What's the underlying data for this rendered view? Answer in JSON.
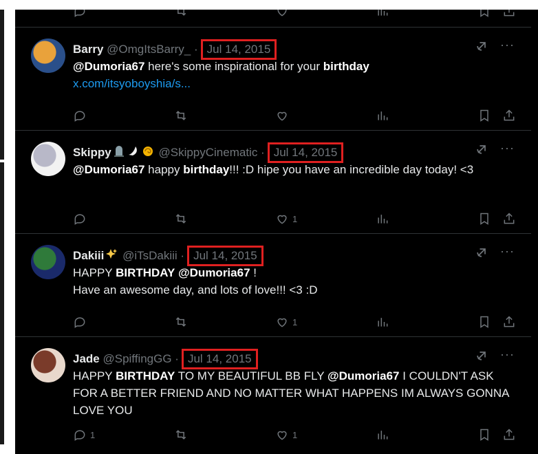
{
  "tweets": [
    {
      "name": "Barry",
      "emojis": [],
      "handle": "@OmgItsBarry_",
      "date": "Jul 14, 2015",
      "text_html_parts": [
        {
          "type": "b",
          "text": "@Dumoria67"
        },
        {
          "type": "t",
          "text": " here's some inspirational for your "
        },
        {
          "type": "b",
          "text": "birthday"
        }
      ],
      "link": "x.com/itsyoboyshia/s...",
      "likes": "",
      "replies": "",
      "avatar_colors": [
        "#2a4f8a",
        "#e9a23b"
      ]
    },
    {
      "name": "Skippy",
      "emojis": [
        "tombstone-emoji",
        "wing-emoji",
        "swirl-emoji"
      ],
      "handle": "@SkippyCinematic",
      "date": "Jul 14, 2015",
      "text_html_parts": [
        {
          "type": "b",
          "text": "@Dumoria67"
        },
        {
          "type": "t",
          "text": " happy "
        },
        {
          "type": "b",
          "text": "birthday"
        },
        {
          "type": "t",
          "text": "!!! :D hipe you have an incredible day today! <3"
        }
      ],
      "link": "",
      "likes": "1",
      "replies": "",
      "avatar_colors": [
        "#f2f2f2",
        "#b8b8c8"
      ]
    },
    {
      "name": "Dakiii",
      "emojis": [
        "sparkles-emoji"
      ],
      "handle": "@iTsDakiii",
      "date": "Jul 14, 2015",
      "text_html_parts": [
        {
          "type": "t",
          "text": "HAPPY "
        },
        {
          "type": "b",
          "text": "BIRTHDAY"
        },
        {
          "type": "t",
          "text": " "
        },
        {
          "type": "b",
          "text": "@Dumoria67"
        },
        {
          "type": "t",
          "text": " !"
        },
        {
          "type": "br"
        },
        {
          "type": "t",
          "text": "Have an awesome day, and lots of love!!! <3 :D"
        }
      ],
      "link": "",
      "likes": "1",
      "replies": "",
      "avatar_colors": [
        "#1a2a6a",
        "#2f7a3a"
      ]
    },
    {
      "name": "Jade",
      "emojis": [],
      "handle": "@SpiffingGG",
      "date": "Jul 14, 2015",
      "text_html_parts": [
        {
          "type": "t",
          "text": "HAPPY "
        },
        {
          "type": "b",
          "text": "BIRTHDAY"
        },
        {
          "type": "t",
          "text": " TO MY BEAUTIFUL BB FLY "
        },
        {
          "type": "b",
          "text": "@Dumoria67"
        },
        {
          "type": "t",
          "text": "  I COULDN'T ASK FOR A BETTER FRIEND AND NO MATTER WHAT HAPPENS IM ALWAYS GONNA LOVE YOU"
        }
      ],
      "link": "",
      "likes": "1",
      "replies": "1",
      "avatar_colors": [
        "#e8d8cc",
        "#7a3b2a"
      ]
    }
  ]
}
